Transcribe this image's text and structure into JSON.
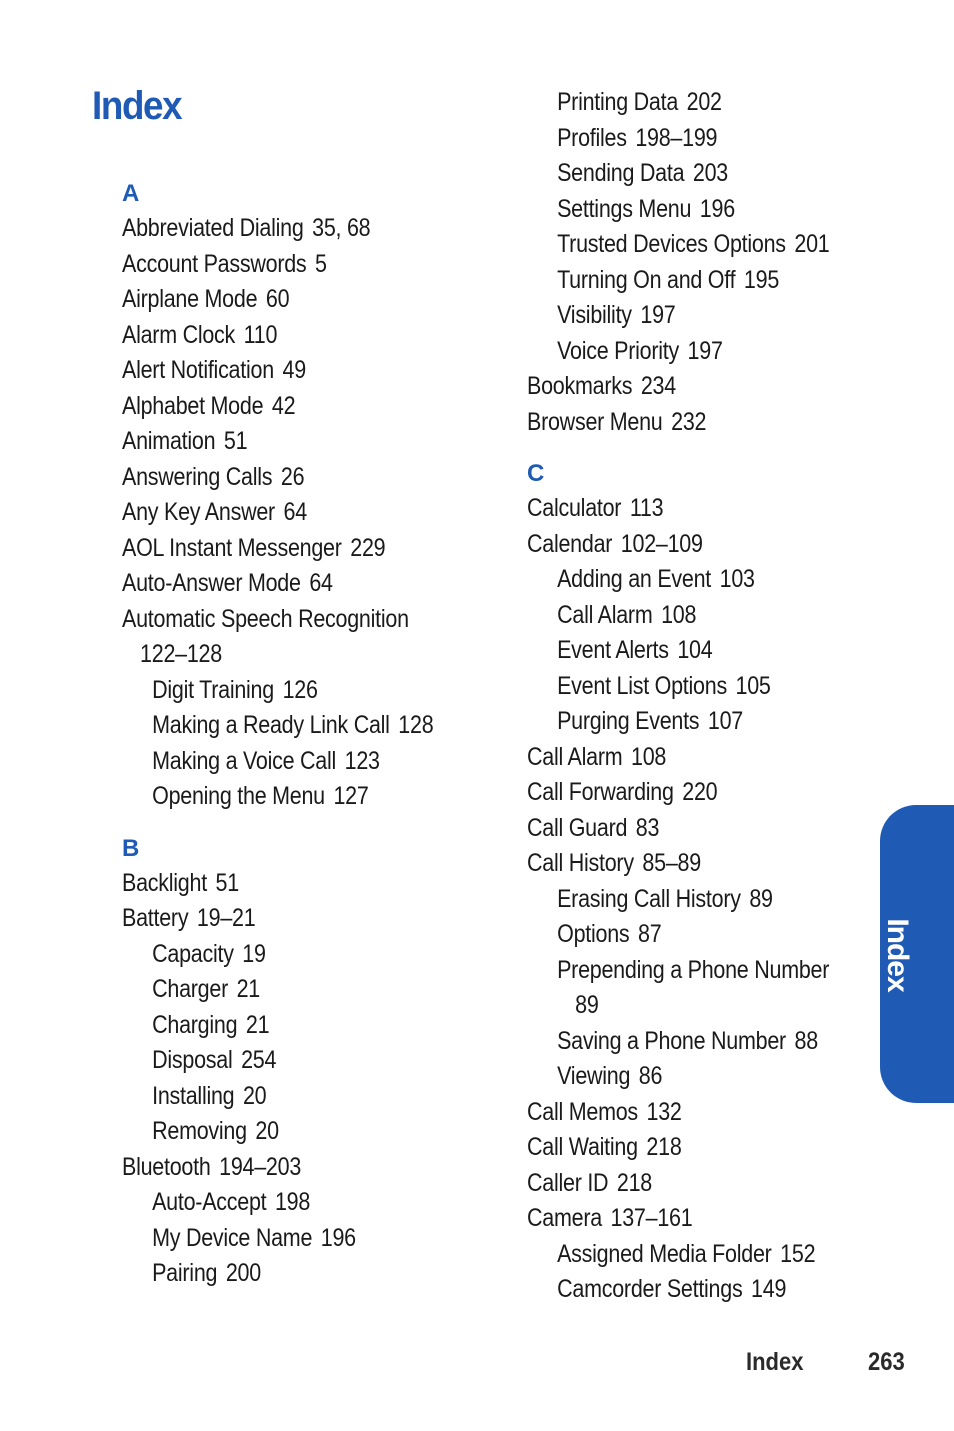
{
  "page": {
    "title": "Index",
    "footer_section": "Index",
    "footer_page": "263",
    "side_tab_label": "Index",
    "accent_color": "#1f5bb5"
  },
  "left_column": [
    {
      "type": "letter",
      "text": "A"
    },
    {
      "type": "entry",
      "text": "Abbreviated Dialing",
      "pages": "35, 68"
    },
    {
      "type": "entry",
      "text": "Account Passwords",
      "pages": "5"
    },
    {
      "type": "entry",
      "text": "Airplane Mode",
      "pages": "60"
    },
    {
      "type": "entry",
      "text": "Alarm Clock",
      "pages": "110"
    },
    {
      "type": "entry",
      "text": "Alert Notification",
      "pages": "49"
    },
    {
      "type": "entry",
      "text": "Alphabet Mode",
      "pages": "42"
    },
    {
      "type": "entry",
      "text": "Animation",
      "pages": "51"
    },
    {
      "type": "entry",
      "text": "Answering Calls",
      "pages": "26"
    },
    {
      "type": "entry",
      "text": "Any Key Answer",
      "pages": "64"
    },
    {
      "type": "entry",
      "text": "AOL Instant Messenger",
      "pages": "229"
    },
    {
      "type": "entry",
      "text": "Auto-Answer Mode",
      "pages": "64"
    },
    {
      "type": "entry",
      "text": "Automatic Speech Recognition",
      "pages": ""
    },
    {
      "type": "cont",
      "text": "",
      "pages": "122–128"
    },
    {
      "type": "sub",
      "text": "Digit Training",
      "pages": "126"
    },
    {
      "type": "sub",
      "text": "Making a Ready Link Call",
      "pages": "128"
    },
    {
      "type": "sub",
      "text": "Making a Voice Call",
      "pages": "123"
    },
    {
      "type": "sub",
      "text": "Opening the Menu",
      "pages": "127"
    },
    {
      "type": "letter",
      "text": "B"
    },
    {
      "type": "entry",
      "text": "Backlight",
      "pages": "51"
    },
    {
      "type": "entry",
      "text": "Battery",
      "pages": "19–21"
    },
    {
      "type": "sub",
      "text": "Capacity",
      "pages": "19"
    },
    {
      "type": "sub",
      "text": "Charger",
      "pages": "21"
    },
    {
      "type": "sub",
      "text": "Charging",
      "pages": "21"
    },
    {
      "type": "sub",
      "text": "Disposal",
      "pages": "254"
    },
    {
      "type": "sub",
      "text": "Installing",
      "pages": "20"
    },
    {
      "type": "sub",
      "text": "Removing",
      "pages": "20"
    },
    {
      "type": "entry",
      "text": "Bluetooth",
      "pages": "194–203"
    },
    {
      "type": "sub",
      "text": "Auto-Accept",
      "pages": "198"
    },
    {
      "type": "sub",
      "text": "My Device Name",
      "pages": "196"
    },
    {
      "type": "sub",
      "text": "Pairing",
      "pages": "200"
    }
  ],
  "right_column": [
    {
      "type": "sub",
      "text": "Printing Data",
      "pages": "202"
    },
    {
      "type": "sub",
      "text": "Profiles",
      "pages": "198–199"
    },
    {
      "type": "sub",
      "text": "Sending Data",
      "pages": "203"
    },
    {
      "type": "sub",
      "text": "Settings Menu",
      "pages": "196"
    },
    {
      "type": "sub",
      "text": "Trusted Devices Options",
      "pages": "201"
    },
    {
      "type": "sub",
      "text": "Turning On and Off",
      "pages": "195"
    },
    {
      "type": "sub",
      "text": "Visibility",
      "pages": "197"
    },
    {
      "type": "sub",
      "text": "Voice Priority",
      "pages": "197"
    },
    {
      "type": "entry",
      "text": "Bookmarks",
      "pages": "234"
    },
    {
      "type": "entry",
      "text": "Browser Menu",
      "pages": "232"
    },
    {
      "type": "letter",
      "text": "C"
    },
    {
      "type": "entry",
      "text": "Calculator",
      "pages": "113"
    },
    {
      "type": "entry",
      "text": "Calendar",
      "pages": "102–109"
    },
    {
      "type": "sub",
      "text": "Adding an Event",
      "pages": "103"
    },
    {
      "type": "sub",
      "text": "Call Alarm",
      "pages": "108"
    },
    {
      "type": "sub",
      "text": "Event Alerts",
      "pages": "104"
    },
    {
      "type": "sub",
      "text": "Event List Options",
      "pages": "105"
    },
    {
      "type": "sub",
      "text": "Purging Events",
      "pages": "107"
    },
    {
      "type": "entry",
      "text": "Call Alarm",
      "pages": "108"
    },
    {
      "type": "entry",
      "text": "Call Forwarding",
      "pages": "220"
    },
    {
      "type": "entry",
      "text": "Call Guard",
      "pages": "83"
    },
    {
      "type": "entry",
      "text": "Call History",
      "pages": "85–89"
    },
    {
      "type": "sub",
      "text": "Erasing Call History",
      "pages": "89"
    },
    {
      "type": "sub",
      "text": "Options",
      "pages": "87"
    },
    {
      "type": "sub",
      "text": "Prepending a Phone Number",
      "pages": ""
    },
    {
      "type": "subcont",
      "text": "",
      "pages": "89"
    },
    {
      "type": "sub",
      "text": "Saving a Phone Number",
      "pages": "88"
    },
    {
      "type": "sub",
      "text": "Viewing",
      "pages": "86"
    },
    {
      "type": "entry",
      "text": "Call Memos",
      "pages": "132"
    },
    {
      "type": "entry",
      "text": "Call Waiting",
      "pages": "218"
    },
    {
      "type": "entry",
      "text": "Caller ID",
      "pages": "218"
    },
    {
      "type": "entry",
      "text": "Camera",
      "pages": "137–161"
    },
    {
      "type": "sub",
      "text": "Assigned Media Folder",
      "pages": "152"
    },
    {
      "type": "sub",
      "text": "Camcorder Settings",
      "pages": "149"
    }
  ]
}
